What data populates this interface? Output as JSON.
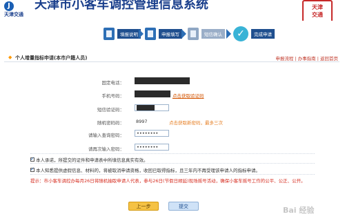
{
  "header": {
    "logo_mark": "J",
    "logo_text": "天津交通",
    "title": "天津市小客车调控管理信息系统",
    "seal_text": "天津交通"
  },
  "steps": [
    {
      "label": "填报说明"
    },
    {
      "label": "申报填写"
    },
    {
      "label": "短信确认"
    },
    {
      "label": "完成申请"
    }
  ],
  "section": {
    "title": "个人增量指标申请(本市户籍人员)",
    "links": "申报流程 | 办事指南 | 返回首页"
  },
  "form": {
    "phone_label": "固定电话：",
    "mobile_label": "手机号码：",
    "get_sms_link": "点击获取验证码",
    "sms_label": "短信验证码：",
    "random_label": "随机密码码：",
    "random_value": "8997",
    "random_hint": "点击获取新密码，最多三次",
    "pwd_label": "请输入查询密码：",
    "pwd_value": "••••••••",
    "pwd2_label": "请再次输入密码：",
    "pwd2_value": "••••••••"
  },
  "agreements": {
    "a1": "本人承诺，所提交的证件和申请表中所填信息真实有效。",
    "a2": "本人知悉提供虚假信息、材料的，将被取消申请资格，收回已取得指标，且三年内不再受理该申请人的指标申请。"
  },
  "tip": "提示：市小客车调控办每月26日将随机抽取申请人代表，参与26日(节假日顺延)现场摇号活动，确保小客车摇号工作的公平、公正、公开。",
  "buttons": {
    "prev": "上一步",
    "submit": "提交"
  },
  "watermark": "Bai 经验"
}
